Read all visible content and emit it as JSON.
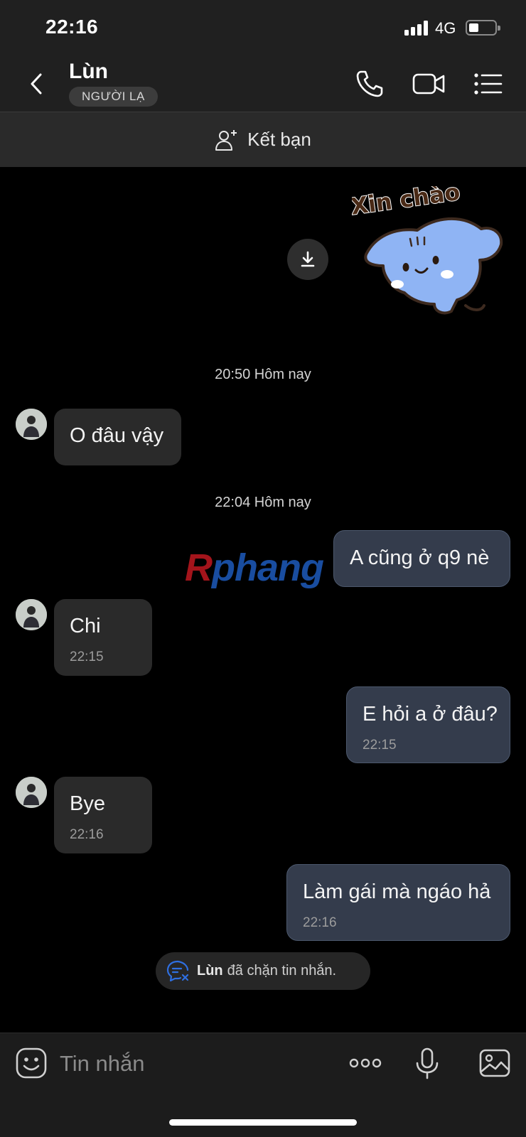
{
  "status_bar": {
    "time": "22:16",
    "network": "4G",
    "battery_level": 0.3
  },
  "header": {
    "contact_name": "Lùn",
    "badge": "NGƯỜI LẠ"
  },
  "friend_bar": {
    "label": "Kết bạn"
  },
  "sticker": {
    "text": "Xin chào"
  },
  "watermark": {
    "part1": "R",
    "part2": "phang"
  },
  "messages": [
    {
      "type": "timestamp",
      "text": "20:50 Hôm nay"
    },
    {
      "type": "in",
      "text": "O đâu vậy"
    },
    {
      "type": "timestamp",
      "text": "22:04 Hôm nay"
    },
    {
      "type": "out",
      "text": "A cũng ở q9 nè"
    },
    {
      "type": "in",
      "text": "Chi",
      "time": "22:15"
    },
    {
      "type": "out",
      "text": "E hỏi a ở đâu?",
      "time": "22:15"
    },
    {
      "type": "in",
      "text": "Bye",
      "time": "22:16"
    },
    {
      "type": "out",
      "text": "Làm gái mà ngáo hả",
      "time": "22:16"
    }
  ],
  "blocked_notice": {
    "name": "Lùn",
    "text": "đã chặn tin nhắn."
  },
  "composer": {
    "placeholder": "Tin nhắn"
  },
  "colors": {
    "incoming_bubble": "#2a2a2a",
    "outgoing_bubble": "#343c4c",
    "background": "#000000"
  }
}
